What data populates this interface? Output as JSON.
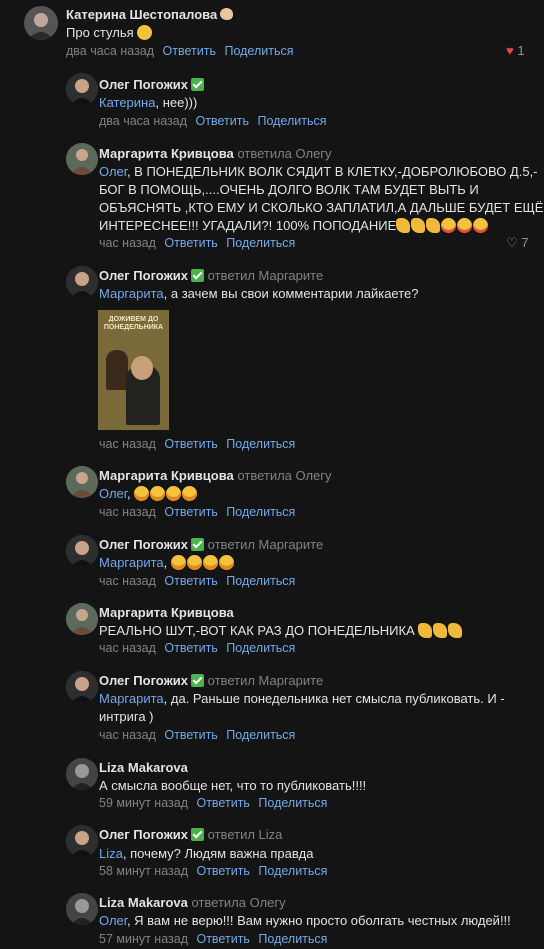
{
  "comments": [
    {
      "author": "Катерина Шестопалова",
      "text": "Про стулья",
      "time": "два часа назад",
      "reply": "Ответить",
      "share": "Поделиться",
      "likes": "1"
    },
    {
      "author": "Олег Погожих",
      "mention": "Катерина",
      "text": ", нее)))",
      "time": "два часа назад",
      "reply": "Ответить",
      "share": "Поделиться"
    },
    {
      "author": "Маргарита Кривцова",
      "replyto": "ответила Олегу",
      "mention": "Олег",
      "text_l1": ", В ПОНЕДЕЛЬНИК ВОЛК СЯДИТ В КЛЕТКУ,-ДОБРОЛЮБОВО Д.5,-",
      "text_l2": "БОГ В ПОМОЩЬ,....ОЧЕНЬ ДОЛГО ВОЛК ТАМ БУДЕТ ВЫТЬ И",
      "text_l3": "ОБЪЯСНЯТЬ ,КТО ЕМУ И СКОЛЬКО ЗАПЛАТИЛ,А ДАЛЬШЕ БУДЕТ ЕЩЁ",
      "text_l4": "ИНТЕРЕСНЕЕ!!! УГАДАЛИ?! 100% ПОПОДАНИЕ",
      "time": "час назад",
      "reply": "Ответить",
      "share": "Поделиться",
      "likes": "7"
    },
    {
      "author": "Олег Погожих",
      "replyto": "ответил Маргарите",
      "mention": "Маргарита",
      "text": ", а зачем вы свои комментарии лайкаете?",
      "poster_title": "ДОЖИВЕМ ДО ПОНЕДЕЛЬНИКА",
      "time": "час назад",
      "reply": "Ответить",
      "share": "Поделиться"
    },
    {
      "author": "Маргарита Кривцова",
      "replyto": "ответила Олегу",
      "mention": "Олег",
      "text": ",",
      "time": "час назад",
      "reply": "Ответить",
      "share": "Поделиться"
    },
    {
      "author": "Олег Погожих",
      "replyto": "ответил Маргарите",
      "mention": "Маргарита",
      "text": ",",
      "time": "час назад",
      "reply": "Ответить",
      "share": "Поделиться"
    },
    {
      "author": "Маргарита Кривцова",
      "text": "РЕАЛЬНО ШУТ,-ВОТ КАК РАЗ ДО ПОНЕДЕЛЬНИКА",
      "time": "час назад",
      "reply": "Ответить",
      "share": "Поделиться"
    },
    {
      "author": "Олег Погожих",
      "replyto": "ответил Маргарите",
      "mention": "Маргарита",
      "text_l1": ", да. Раньше понедельника нет смысла публиковать. И -",
      "text_l2": "интрига )",
      "time": "час назад",
      "reply": "Ответить",
      "share": "Поделиться"
    },
    {
      "author": "Liza Makarova",
      "text": "А смысла вообще нет, что то публиковать!!!!",
      "time": "59 минут назад",
      "reply": "Ответить",
      "share": "Поделиться"
    },
    {
      "author": "Олег Погожих",
      "replyto": "ответил Liza",
      "mention": "Liza",
      "text": ", почему? Людям важна правда",
      "time": "58 минут назад",
      "reply": "Ответить",
      "share": "Поделиться"
    },
    {
      "author": "Liza Makarova",
      "replyto": "ответила Олегу",
      "mention": "Олег",
      "text": ", Я вам не верю!!! Вам нужно просто оболгать честных людей!!!",
      "time": "57 минут назад",
      "reply": "Ответить",
      "share": "Поделиться"
    }
  ],
  "colors": {
    "background": "#141414",
    "text": "#e1e3e6",
    "link": "#71aaeb",
    "muted": "#828282",
    "verified": "#4bb34b",
    "heart": "#e64646"
  }
}
